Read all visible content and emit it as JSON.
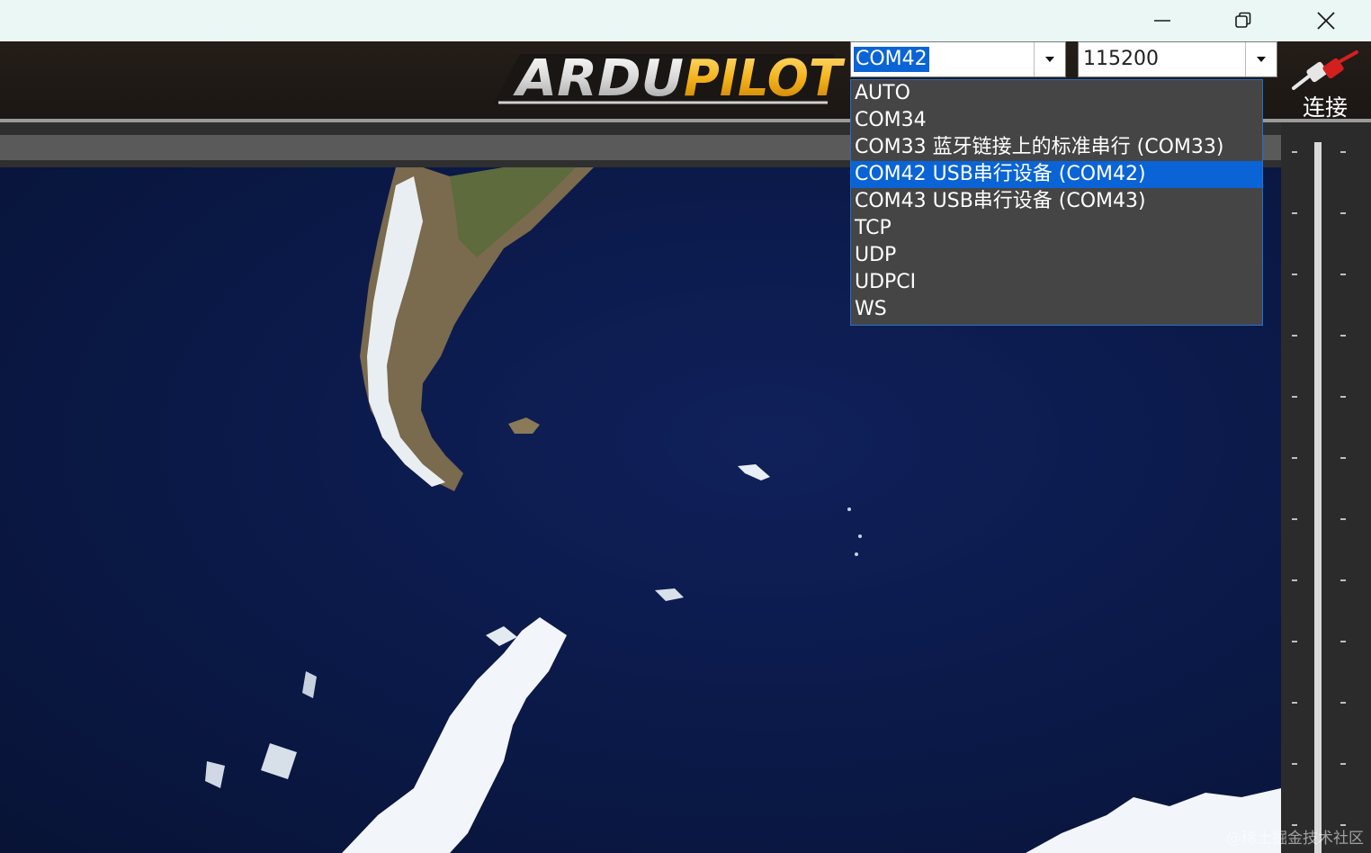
{
  "window": {
    "minimize_icon": "minimize-icon",
    "restore_icon": "restore-icon",
    "close_icon": "close-icon"
  },
  "logo": {
    "text": "ARDUPILOT"
  },
  "port_combo": {
    "value": "COM42"
  },
  "baud_combo": {
    "value": "115200"
  },
  "port_options": [
    "AUTO",
    "COM34",
    "COM33 蓝牙链接上的标准串行 (COM33)",
    "COM42  USB串行设备 (COM42)",
    "COM43  USB串行设备 (COM43)",
    "TCP",
    "UDP",
    "UDPCI",
    "WS"
  ],
  "highlighted_option_index": 3,
  "connect": {
    "label": "连接",
    "icon": "plug-icon"
  },
  "watermark": "@稀土掘金技术社区",
  "colors": {
    "selection": "#0a64d6",
    "dropdown_bg": "#454545",
    "titlebar": "#eaf7f4"
  }
}
